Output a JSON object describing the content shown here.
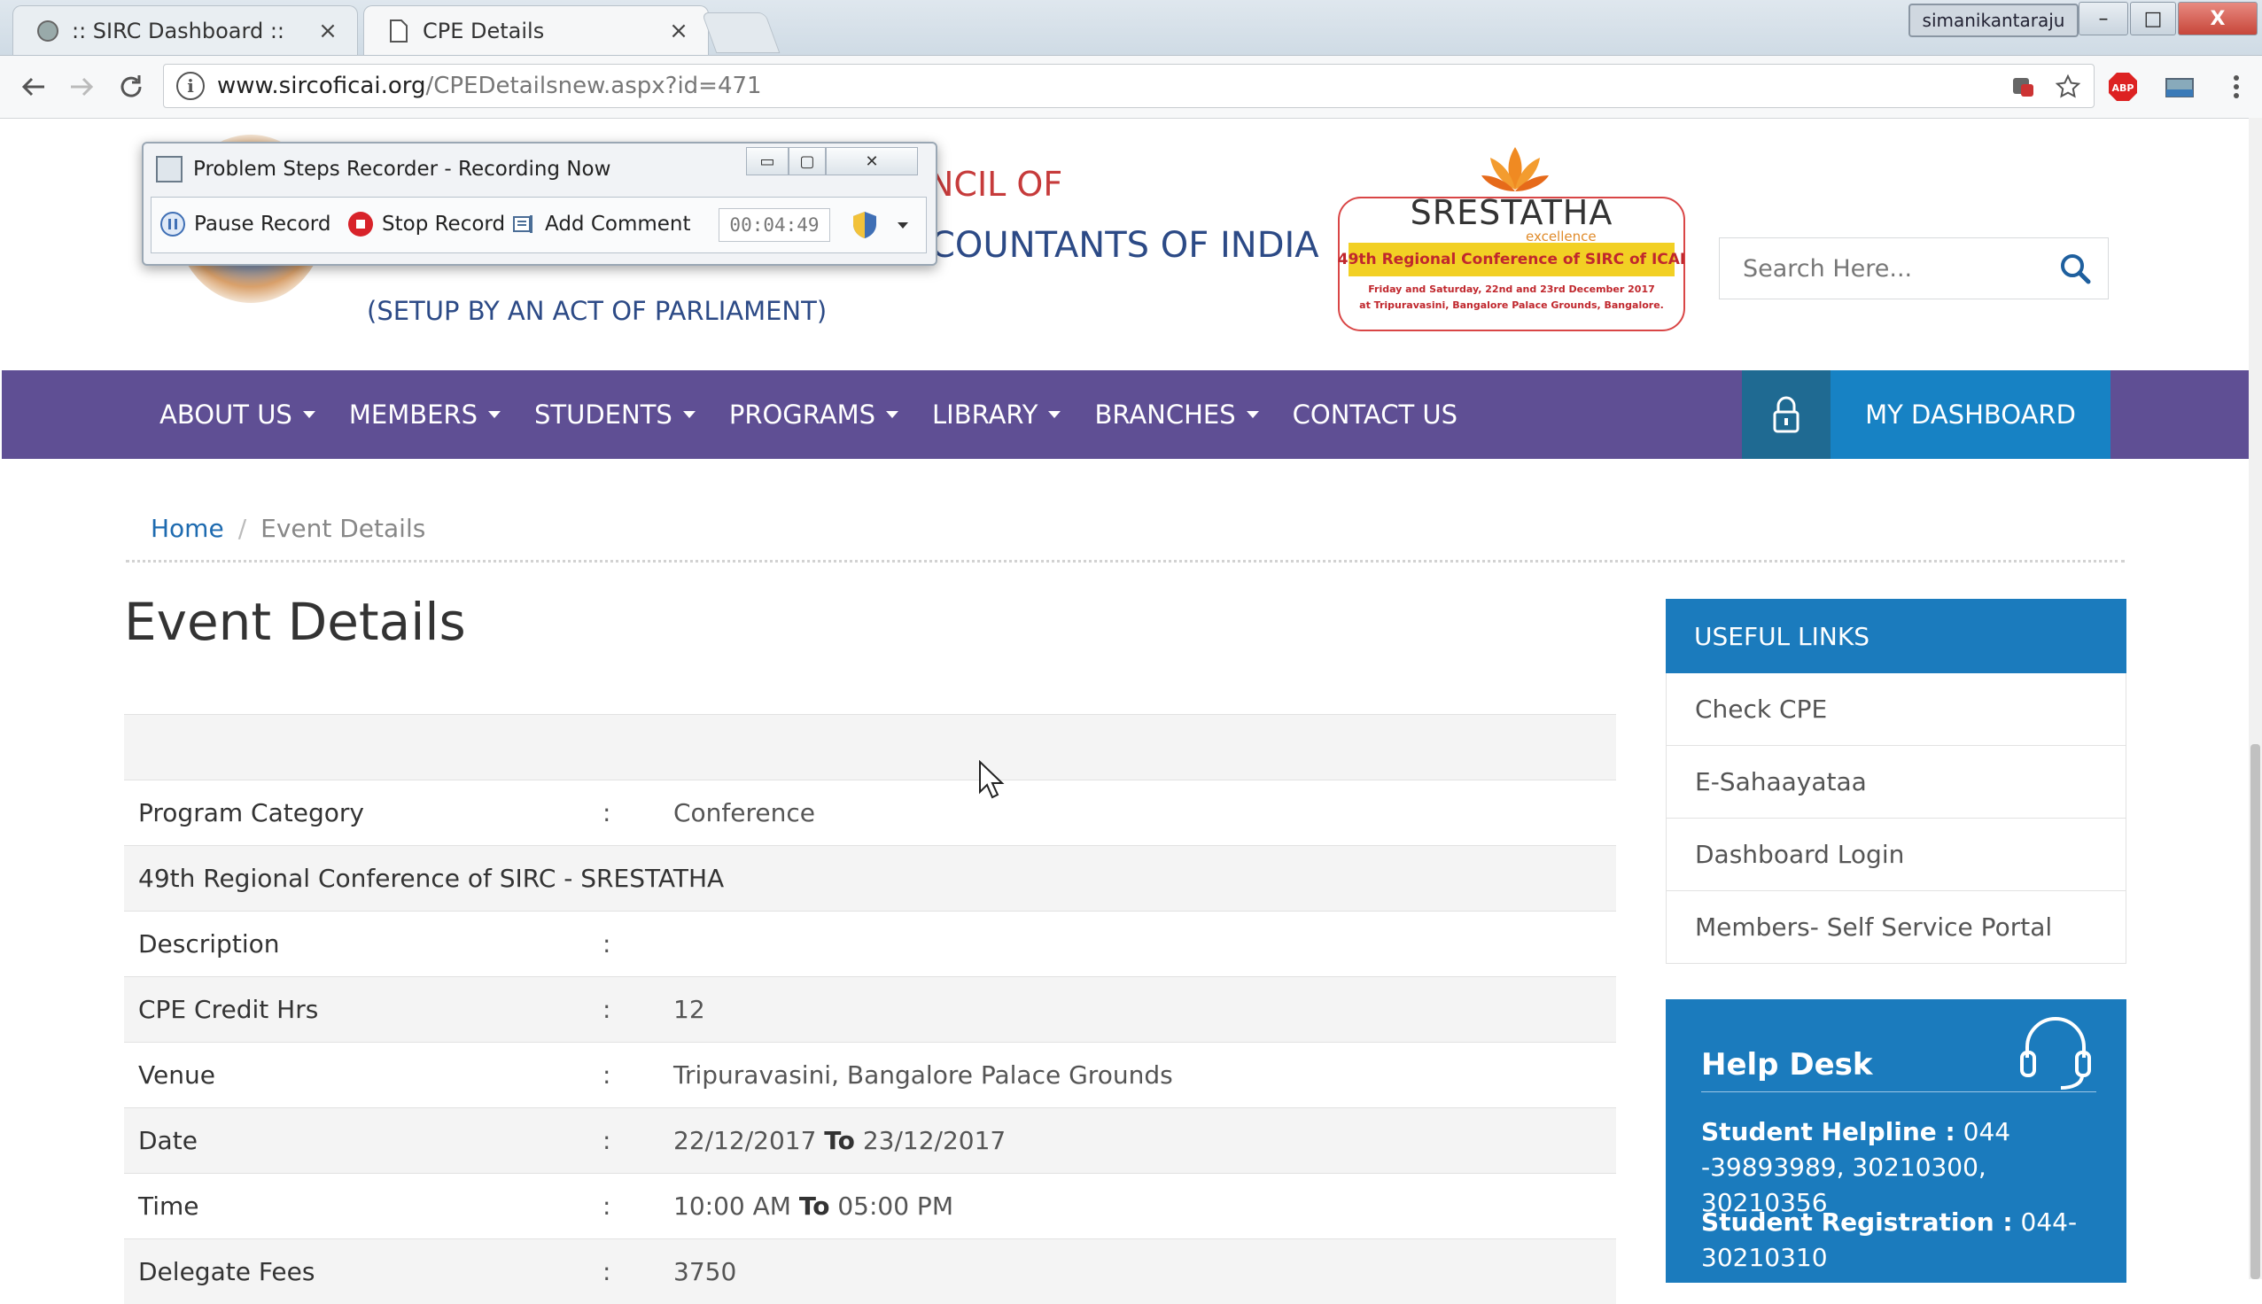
{
  "browser": {
    "tabs": [
      {
        "label": ":: SIRC Dashboard ::",
        "close": "×"
      },
      {
        "label": "CPE Details",
        "close": "×"
      }
    ],
    "profile_name": "simanikantaraju",
    "window_buttons": {
      "min": "–",
      "max": "□",
      "close": "X"
    },
    "url_host": "www.sircoficai.org",
    "url_path": "/CPEDetailsnew.aspx?id=471",
    "ext_abp": "ABP"
  },
  "psr": {
    "title": "Problem Steps Recorder - Recording Now",
    "pause_label": "Pause Record",
    "stop_label": "Stop Record",
    "comment_label": "Add Comment",
    "timer": "00:04:49",
    "win_min": "▭",
    "win_max": "▢",
    "win_close": "✕"
  },
  "header": {
    "council_line1": "NCIL OF",
    "council_line2": "COUNTANTS OF INDIA",
    "setup": "(SETUP BY AN ACT OF PARLIAMENT)",
    "conference": {
      "brand": "SRESTATHA",
      "tag": "excellence",
      "strip": "49th Regional Conference of SIRC of ICAI",
      "sub1": "Friday and Saturday, 22nd and 23rd December 2017",
      "sub2": "at Tripuravasini, Bangalore Palace Grounds, Bangalore."
    },
    "search_placeholder": "Search Here..."
  },
  "nav": {
    "items": [
      {
        "label": "ABOUT US",
        "dropdown": true
      },
      {
        "label": "MEMBERS",
        "dropdown": true
      },
      {
        "label": "STUDENTS",
        "dropdown": true
      },
      {
        "label": "PROGRAMS",
        "dropdown": true
      },
      {
        "label": "LIBRARY",
        "dropdown": true
      },
      {
        "label": "BRANCHES",
        "dropdown": true
      },
      {
        "label": "CONTACT US",
        "dropdown": false
      }
    ],
    "dashboard_label": "MY DASHBOARD"
  },
  "breadcrumb": {
    "home": "Home",
    "separator": "/",
    "current": "Event Details"
  },
  "page_title": "Event Details",
  "details": {
    "colon": ":",
    "to": "To",
    "program_category_label": "Program Category",
    "program_category_value": "Conference",
    "event_name": "49th Regional Conference of SIRC - SRESTATHA",
    "description_label": "Description",
    "cpe_label": "CPE Credit Hrs",
    "cpe_value": "12",
    "venue_label": "Venue",
    "venue_value": "Tripuravasini, Bangalore Palace Grounds",
    "date_label": "Date",
    "date_from": "22/12/2017",
    "date_to": "23/12/2017",
    "time_label": "Time",
    "time_from": "10:00 AM",
    "time_to": "05:00 PM",
    "fees_label": "Delegate Fees",
    "fees_value": "3750"
  },
  "useful_links": {
    "heading": "USEFUL LINKS",
    "items": [
      "Check CPE",
      "E-Sahaayataa",
      "Dashboard Login",
      "Members- Self Service Portal"
    ]
  },
  "helpdesk": {
    "title": "Help Desk",
    "student_helpline_label": "Student Helpline :",
    "student_helpline_value": "044 -39893989, 30210300, 30210356",
    "student_registration_label": "Student Registration :",
    "student_registration_value": "044-30210310"
  },
  "colors": {
    "nav_purple": "#5f4f94",
    "accent_blue": "#1b7bbd",
    "title_red": "#c63b3b",
    "title_navy": "#2c4a86"
  }
}
